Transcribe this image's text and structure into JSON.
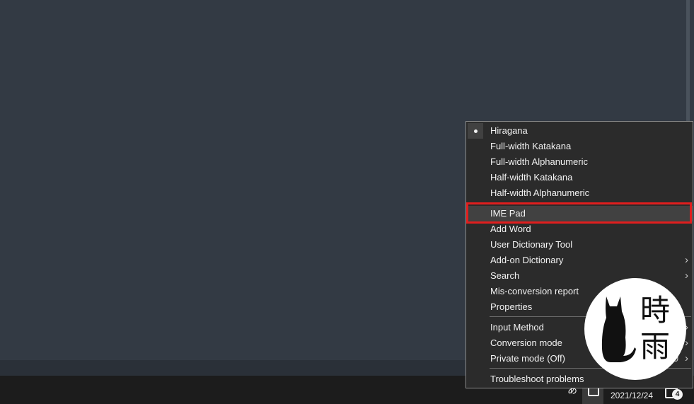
{
  "menu": {
    "items": [
      {
        "label": "Hiragana",
        "checked": true
      },
      {
        "label": "Full-width Katakana"
      },
      {
        "label": "Full-width Alphanumeric"
      },
      {
        "label": "Half-width Katakana"
      },
      {
        "label": "Half-width Alphanumeric"
      },
      {
        "label": "IME Pad",
        "highlighted": true
      },
      {
        "label": "Add Word"
      },
      {
        "label": "User Dictionary Tool"
      },
      {
        "label": "Add-on Dictionary",
        "submenu": true
      },
      {
        "label": "Search",
        "submenu": true
      },
      {
        "label": "Mis-conversion report"
      },
      {
        "label": "Properties"
      },
      {
        "label": "Input Method",
        "submenu": true
      },
      {
        "label": "Conversion mode",
        "submenu": true
      },
      {
        "label": "Private mode (Off)",
        "extra": "0",
        "submenu": true
      },
      {
        "label": "Troubleshoot problems"
      }
    ],
    "chevron_glyph": "›",
    "highlight_color": "#e01e1e"
  },
  "taskbar": {
    "ime_mode": "あ",
    "date": "2021/12/24",
    "notification_count": "4"
  },
  "watermark": {
    "characters": [
      "時",
      "雨"
    ]
  }
}
